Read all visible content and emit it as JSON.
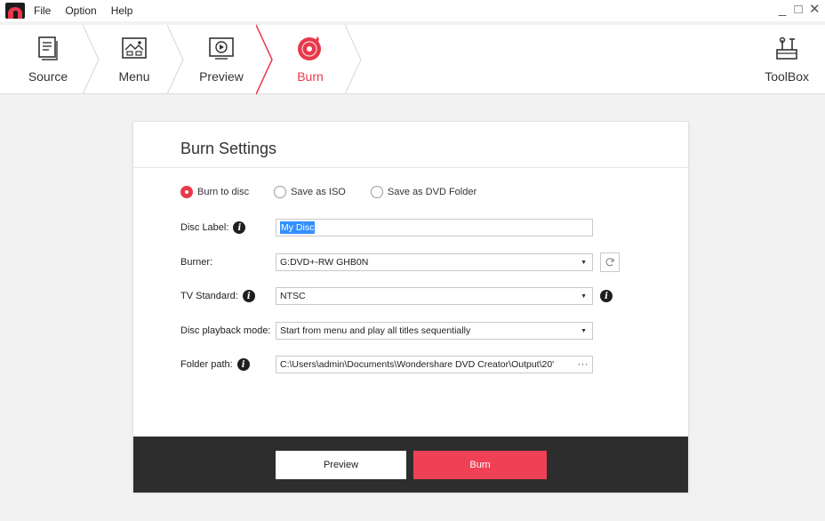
{
  "menu": {
    "file": "File",
    "option": "Option",
    "help": "Help"
  },
  "window": {
    "minimize": "_",
    "maximize": "□",
    "close": "✕"
  },
  "steps": [
    {
      "label": "Source",
      "icon": "document-icon",
      "active": false
    },
    {
      "label": "Menu",
      "icon": "picture-menu-icon",
      "active": false
    },
    {
      "label": "Preview",
      "icon": "play-icon",
      "active": false
    },
    {
      "label": "Burn",
      "icon": "disc-burn-icon",
      "active": true
    }
  ],
  "toolbox": {
    "label": "ToolBox",
    "icon": "toolbox-icon"
  },
  "settings": {
    "title": "Burn Settings",
    "output_options": [
      {
        "label": "Burn to disc",
        "checked": true
      },
      {
        "label": "Save as ISO",
        "checked": false
      },
      {
        "label": "Save as DVD Folder",
        "checked": false
      }
    ],
    "disc_label": {
      "label": "Disc Label:",
      "value": "My Disc"
    },
    "burner": {
      "label": "Burner:",
      "value": "G:DVD+-RW GHB0N"
    },
    "tv_standard": {
      "label": "TV Standard:",
      "value": "NTSC"
    },
    "playback_mode": {
      "label": "Disc playback mode:",
      "value": "Start from menu and play all titles sequentially"
    },
    "folder_path": {
      "label": "Folder path:",
      "value": "C:\\Users\\admin\\Documents\\Wondershare DVD Creator\\Output\\20'",
      "more": "···"
    }
  },
  "actions": {
    "preview": "Preview",
    "burn": "Burn"
  },
  "colors": {
    "accent": "#e8394a",
    "burn_button": "#ef4055",
    "footer": "#2d2d2d"
  }
}
